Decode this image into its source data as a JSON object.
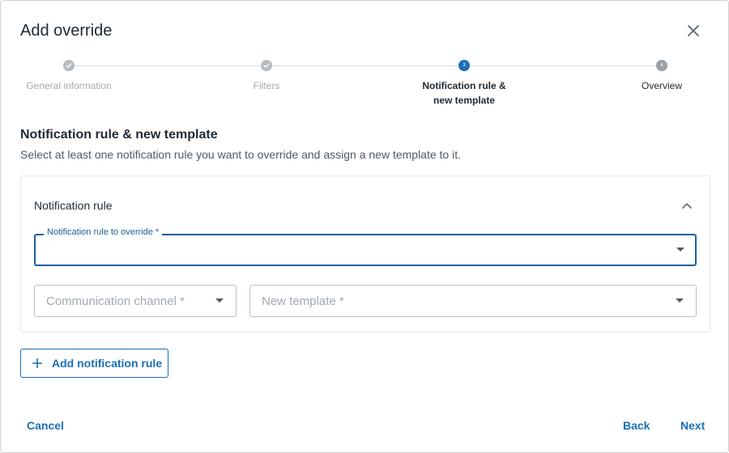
{
  "dialog": {
    "title": "Add override",
    "close_icon": "close-icon"
  },
  "stepper": {
    "steps": [
      {
        "label": "General information",
        "state": "completed",
        "indicator": "check-icon"
      },
      {
        "label": "Filters",
        "state": "completed",
        "indicator": "check-icon"
      },
      {
        "label": "Notification rule & new template",
        "state": "active",
        "indicator": "3"
      },
      {
        "label": "Overview",
        "state": "pending",
        "indicator": "4"
      }
    ]
  },
  "section": {
    "title": "Notification rule & new template",
    "description": "Select at least one notification rule you want to override and assign a new template to it."
  },
  "rule_card": {
    "title": "Notification rule",
    "collapse_icon": "chevron-up-icon",
    "rule_field": {
      "label": "Notification rule to override *",
      "value": ""
    },
    "channel_field": {
      "placeholder": "Communication channel *",
      "value": ""
    },
    "template_field": {
      "placeholder": "New template *",
      "value": ""
    }
  },
  "add_rule_button": {
    "label": "Add notification rule",
    "icon": "plus-icon"
  },
  "footer": {
    "cancel_label": "Cancel",
    "back_label": "Back",
    "next_label": "Next"
  },
  "colors": {
    "primary": "#1a6fb5",
    "focus_border": "#1a5f9e",
    "completed_step": "#b5bcc2"
  }
}
